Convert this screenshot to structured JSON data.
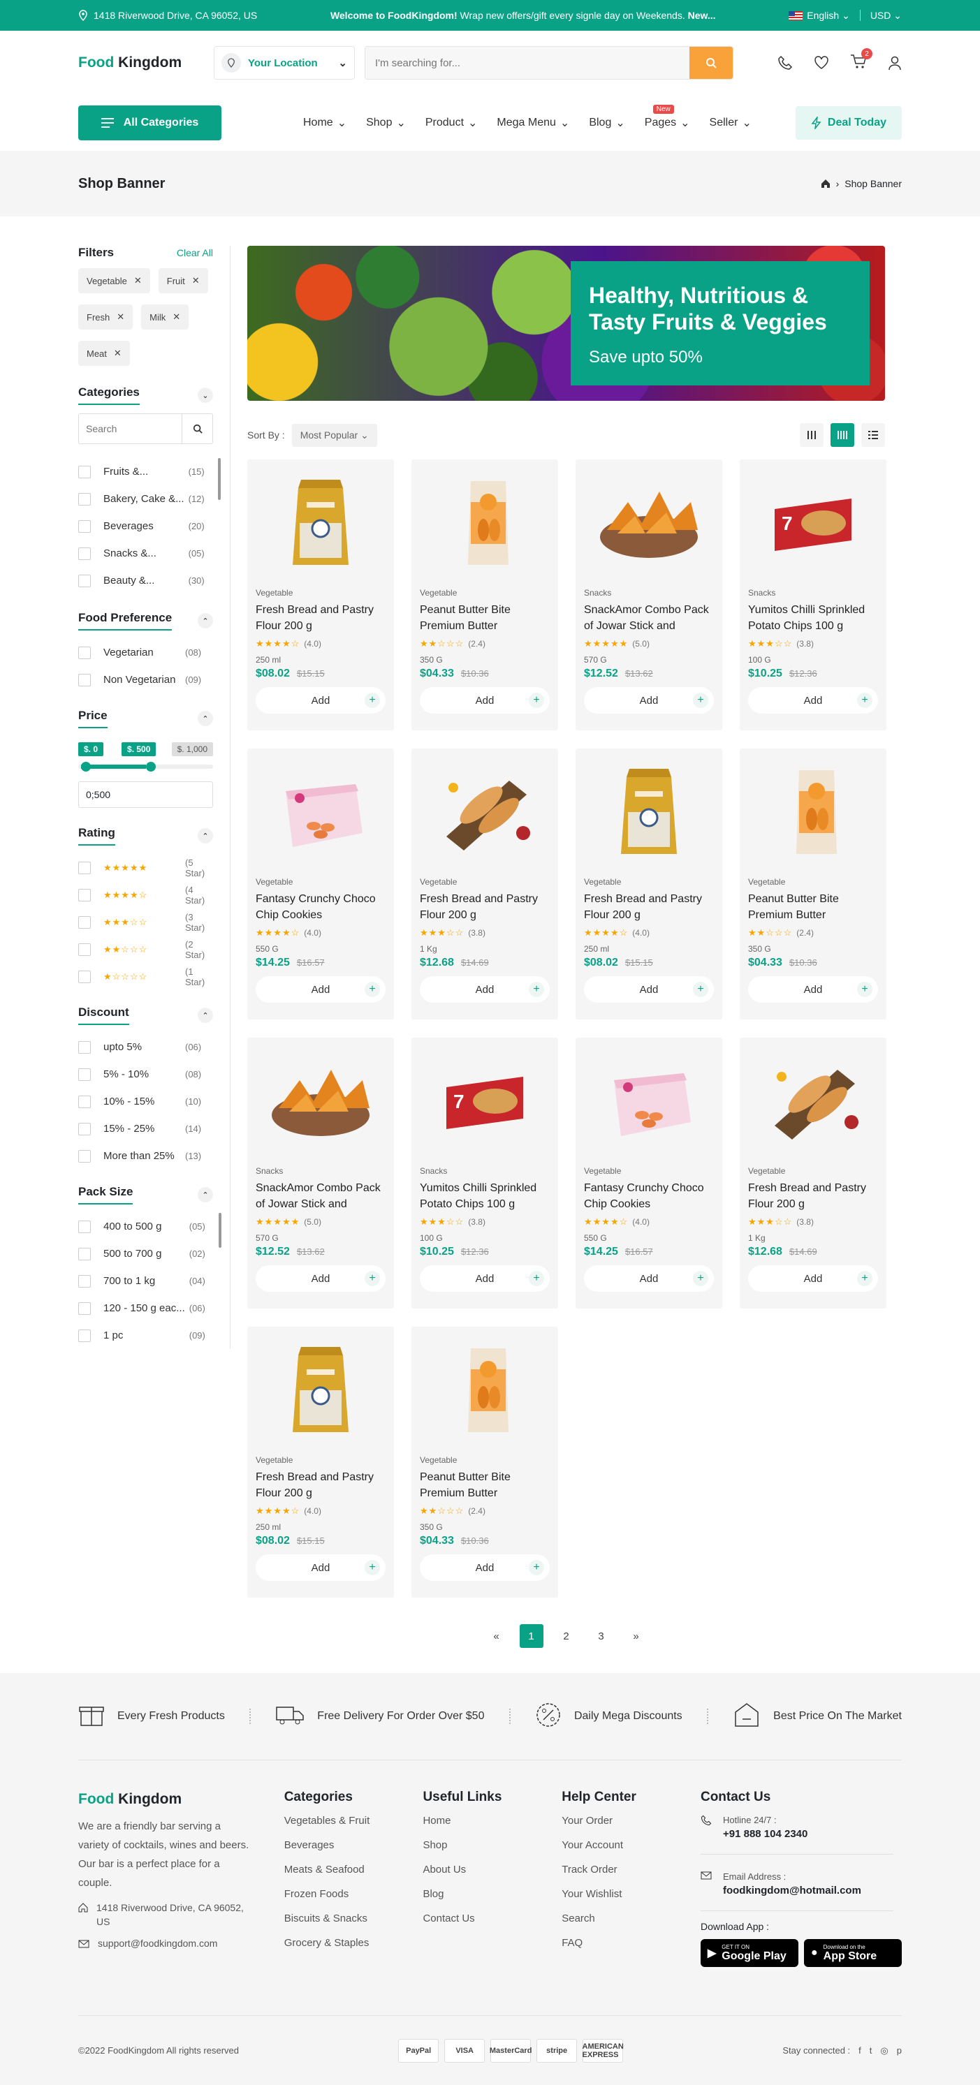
{
  "topbar": {
    "address": "1418 Riverwood Drive, CA 96052, US",
    "promo_bold": "Welcome to FoodKingdom!",
    "promo_text": " Wrap new offers/gift every signle day on Weekends.",
    "promo_new": " New...",
    "language": "English",
    "currency": "USD"
  },
  "header": {
    "logo_green": "Food",
    "logo_dark": " Kingdom",
    "location_label": "Your Location",
    "search_placeholder": "I'm searching for...",
    "cart_count": "2"
  },
  "nav": {
    "all_categories": "All Categories",
    "items": [
      {
        "label": "Home"
      },
      {
        "label": "Shop"
      },
      {
        "label": "Product"
      },
      {
        "label": "Mega Menu"
      },
      {
        "label": "Blog"
      },
      {
        "label": "Pages",
        "badge": "New"
      },
      {
        "label": "Seller"
      }
    ],
    "deal": "Deal Today"
  },
  "page": {
    "title": "Shop Banner",
    "breadcrumb": "Shop Banner"
  },
  "filters": {
    "title": "Filters",
    "clear": "Clear All",
    "tags": [
      "Vegetable",
      "Fruit",
      "Fresh",
      "Milk",
      "Meat"
    ],
    "categories": {
      "title": "Categories",
      "search_placeholder": "Search",
      "items": [
        {
          "label": "Fruits &...",
          "count": "(15)"
        },
        {
          "label": "Bakery, Cake &...",
          "count": "(12)"
        },
        {
          "label": "Beverages",
          "count": "(20)"
        },
        {
          "label": "Snacks &...",
          "count": "(05)"
        },
        {
          "label": "Beauty &...",
          "count": "(30)"
        }
      ]
    },
    "food_pref": {
      "title": "Food Preference",
      "items": [
        {
          "label": "Vegetarian",
          "count": "(08)"
        },
        {
          "label": "Non Vegetarian",
          "count": "(09)"
        }
      ]
    },
    "price": {
      "title": "Price",
      "min_label": "$. 0",
      "max_label": "$. 500",
      "limit_label": "$. 1,000",
      "input_value": "0;500",
      "min_value": 0,
      "max_value": 500,
      "limit": 1000
    },
    "rating": {
      "title": "Rating",
      "items": [
        {
          "stars": 5,
          "label": "(5 Star)"
        },
        {
          "stars": 4,
          "label": "(4 Star)"
        },
        {
          "stars": 3,
          "label": "(3 Star)"
        },
        {
          "stars": 2,
          "label": "(2 Star)"
        },
        {
          "stars": 1,
          "label": "(1 Star)"
        }
      ]
    },
    "discount": {
      "title": "Discount",
      "items": [
        {
          "label": "upto 5%",
          "count": "(06)"
        },
        {
          "label": "5% - 10%",
          "count": "(08)"
        },
        {
          "label": "10% - 15%",
          "count": "(10)"
        },
        {
          "label": "15% - 25%",
          "count": "(14)"
        },
        {
          "label": "More than 25%",
          "count": "(13)"
        }
      ]
    },
    "pack": {
      "title": "Pack Size",
      "items": [
        {
          "label": "400 to 500 g",
          "count": "(05)"
        },
        {
          "label": "500 to 700 g",
          "count": "(02)"
        },
        {
          "label": "700 to 1 kg",
          "count": "(04)"
        },
        {
          "label": "120 - 150 g eac...",
          "count": "(06)"
        },
        {
          "label": "1 pc",
          "count": "(09)"
        }
      ]
    }
  },
  "banner": {
    "title": "Healthy, Nutritious & Tasty Fruits & Veggies",
    "subtitle": "Save upto 50%"
  },
  "sort": {
    "label": "Sort By :",
    "value": "Most Popular"
  },
  "add_label": "Add",
  "products": [
    {
      "img": "flour",
      "cat": "Vegetable",
      "name": "Fresh Bread and Pastry Flour 200 g",
      "rating": 4,
      "rating_text": "(4.0)",
      "weight": "250 ml",
      "price": "$08.02",
      "old": "$15.15"
    },
    {
      "img": "cookies",
      "cat": "Vegetable",
      "name": "Peanut Butter Bite Premium Butter Cookies…",
      "rating": 2,
      "rating_text": "(2.4)",
      "weight": "350 G",
      "price": "$04.33",
      "old": "$10.36"
    },
    {
      "img": "chips",
      "cat": "Snacks",
      "name": "SnackAmor Combo Pack of Jowar Stick and Jowa…",
      "rating": 5,
      "rating_text": "(5.0)",
      "weight": "570 G",
      "price": "$12.52",
      "old": "$13.62"
    },
    {
      "img": "croissant",
      "cat": "Snacks",
      "name": "Yumitos Chilli Sprinkled Potato Chips 100 g",
      "rating": 3,
      "rating_text": "(3.8)",
      "weight": "100 G",
      "price": "$10.25",
      "old": "$12.36"
    },
    {
      "img": "choco",
      "cat": "Vegetable",
      "name": "Fantasy Crunchy Choco Chip Cookies",
      "rating": 4,
      "rating_text": "(4.0)",
      "weight": "550 G",
      "price": "$14.25",
      "old": "$16.57"
    },
    {
      "img": "bread",
      "cat": "Vegetable",
      "name": "Fresh Bread and Pastry Flour 200 g",
      "rating": 3,
      "rating_text": "(3.8)",
      "weight": "1 Kg",
      "price": "$12.68",
      "old": "$14.69"
    },
    {
      "img": "flour",
      "cat": "Vegetable",
      "name": "Fresh Bread and Pastry Flour 200 g",
      "rating": 4,
      "rating_text": "(4.0)",
      "weight": "250 ml",
      "price": "$08.02",
      "old": "$15.15"
    },
    {
      "img": "cookies",
      "cat": "Vegetable",
      "name": "Peanut Butter Bite Premium Butter Cookies…",
      "rating": 2,
      "rating_text": "(2.4)",
      "weight": "350 G",
      "price": "$04.33",
      "old": "$10.36"
    },
    {
      "img": "chips",
      "cat": "Snacks",
      "name": "SnackAmor Combo Pack of Jowar Stick and Jowa…",
      "rating": 5,
      "rating_text": "(5.0)",
      "weight": "570 G",
      "price": "$12.52",
      "old": "$13.62"
    },
    {
      "img": "croissant",
      "cat": "Snacks",
      "name": "Yumitos Chilli Sprinkled Potato Chips 100 g",
      "rating": 3,
      "rating_text": "(3.8)",
      "weight": "100 G",
      "price": "$10.25",
      "old": "$12.36"
    },
    {
      "img": "choco",
      "cat": "Vegetable",
      "name": "Fantasy Crunchy Choco Chip Cookies",
      "rating": 4,
      "rating_text": "(4.0)",
      "weight": "550 G",
      "price": "$14.25",
      "old": "$16.57"
    },
    {
      "img": "bread",
      "cat": "Vegetable",
      "name": "Fresh Bread and Pastry Flour 200 g",
      "rating": 3,
      "rating_text": "(3.8)",
      "weight": "1 Kg",
      "price": "$12.68",
      "old": "$14.69"
    },
    {
      "img": "flour",
      "cat": "Vegetable",
      "name": "Fresh Bread and Pastry Flour 200 g",
      "rating": 4,
      "rating_text": "(4.0)",
      "weight": "250 ml",
      "price": "$08.02",
      "old": "$15.15"
    },
    {
      "img": "cookies",
      "cat": "Vegetable",
      "name": "Peanut Butter Bite Premium Butter Cookies…",
      "rating": 2,
      "rating_text": "(2.4)",
      "weight": "350 G",
      "price": "$04.33",
      "old": "$10.36"
    }
  ],
  "pagination": {
    "prev": "«",
    "pages": [
      "1",
      "2",
      "3"
    ],
    "next": "»",
    "active": "1"
  },
  "features": [
    "Every Fresh Products",
    "Free Delivery For Order Over $50",
    "Daily Mega Discounts",
    "Best Price On The Market"
  ],
  "footer": {
    "about": "We are a friendly bar serving a variety of cocktails, wines and beers. Our bar is a perfect place for a couple.",
    "address": "1418 Riverwood Drive, CA 96052, US",
    "email": "support@foodkingdom.com",
    "categories_title": "Categories",
    "categories": [
      "Vegetables & Fruit",
      "Beverages",
      "Meats & Seafood",
      "Frozen Foods",
      "Biscuits & Snacks",
      "Grocery & Staples"
    ],
    "useful_title": "Useful Links",
    "useful": [
      "Home",
      "Shop",
      "About Us",
      "Blog",
      "Contact Us"
    ],
    "help_title": "Help Center",
    "help": [
      "Your Order",
      "Your Account",
      "Track Order",
      "Your Wishlist",
      "Search",
      "FAQ"
    ],
    "contact_title": "Contact Us",
    "hotline_label": "Hotline 24/7 :",
    "hotline": "+91 888 104 2340",
    "email_label": "Email Address :",
    "contact_email": "foodkingdom@hotmail.com",
    "download": "Download App :",
    "gplay_small": "GET IT ON",
    "gplay": "Google Play",
    "appstore_small": "Download on the",
    "appstore": "App Store",
    "copyright": "©2022 FoodKingdom All rights reserved",
    "payments": [
      "PayPal",
      "VISA",
      "MasterCard",
      "stripe",
      "AMERICAN EXPRESS"
    ],
    "stay": "Stay connected :",
    "socials": [
      "f",
      "t",
      "◎",
      "p"
    ]
  },
  "colors": {
    "primary": "#0aa287",
    "accent": "#f9a23a",
    "star": "#f7a500"
  }
}
